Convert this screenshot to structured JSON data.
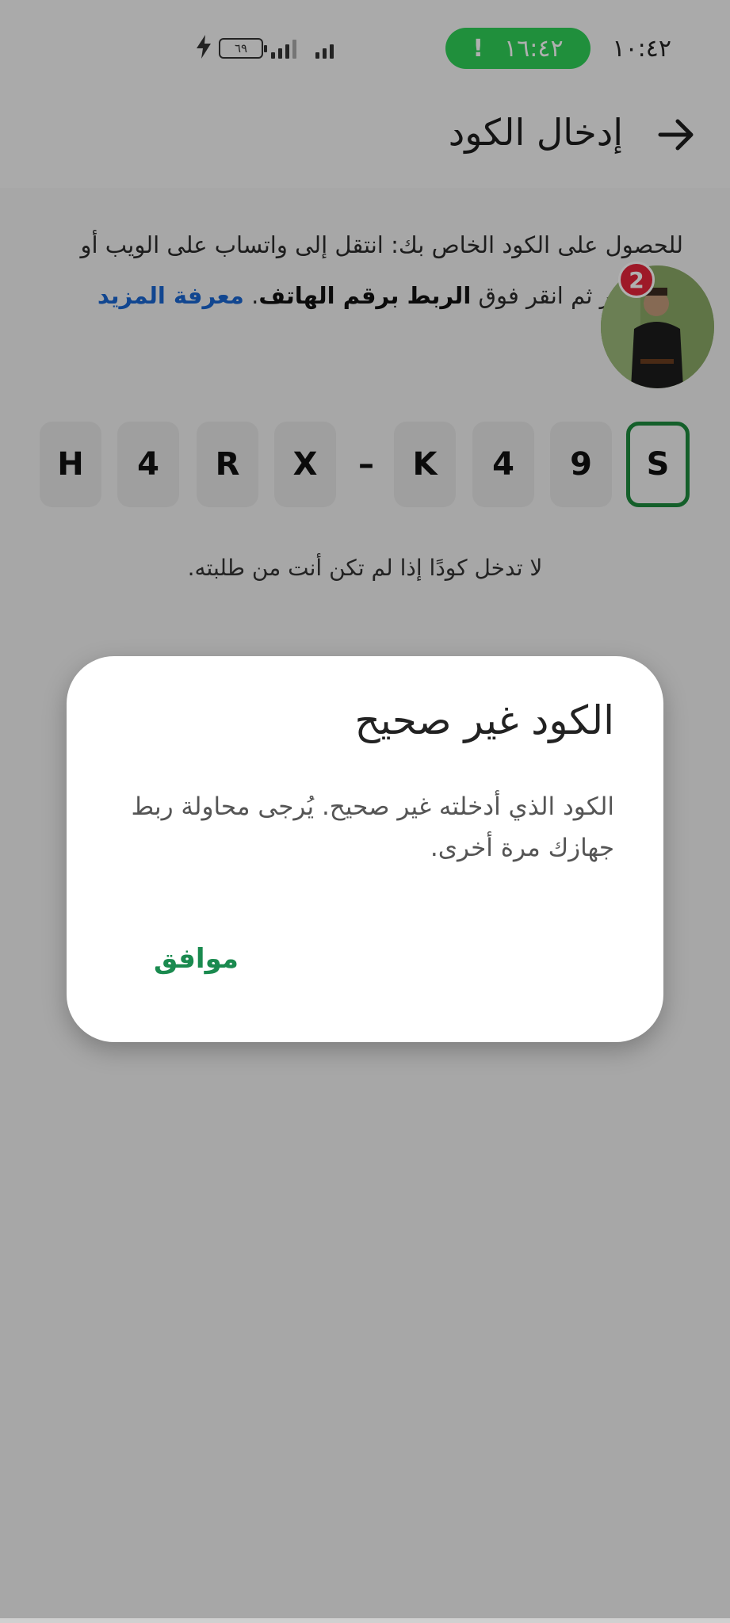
{
  "status_bar": {
    "time": "١٠:٤٢",
    "call_timer": "١٦:٤٢",
    "call_icon": "!",
    "battery": "٦٩",
    "charging_icon": "bolt-icon"
  },
  "app_bar": {
    "title": "إدخال الكود",
    "back_icon": "arrow-right-icon"
  },
  "instructions": {
    "line1": "للحصول على الكود الخاص بك: انتقل إلى واتساب على الويب أو",
    "line2_prefix": "جهاز آخر ثم انقر فوق ",
    "line2_bold": "الربط برقم الهاتف",
    "line2_suffix": ". ",
    "learn_more": "معرفة المزيد"
  },
  "chat_head": {
    "badge_count": "2"
  },
  "code": {
    "chars": [
      "S",
      "9",
      "4",
      "K",
      "X",
      "R",
      "4",
      "H"
    ],
    "separator": "–"
  },
  "warning_text": "لا تدخل كودًا إذا لم تكن أنت من طلبته.",
  "dialog": {
    "title": "الكود غير صحيح",
    "body": "الكود الذي أدخلته غير صحيح. يُرجى محاولة ربط جهازك مرة أخرى.",
    "ok_label": "موافق"
  },
  "colors": {
    "accent_green": "#1a8a4f",
    "call_pill": "#2fd057",
    "link_blue": "#1a66d1",
    "badge_red": "#e5253a"
  }
}
